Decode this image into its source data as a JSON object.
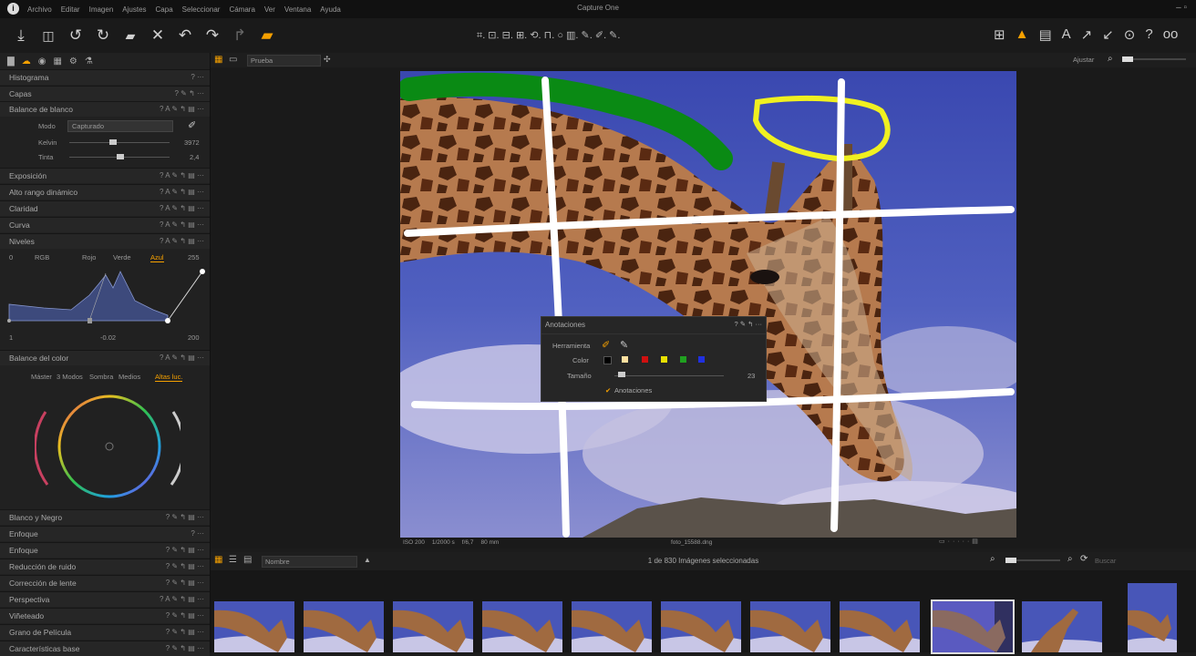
{
  "titlebar": {
    "app_title": "Capture One",
    "menu": [
      "Archivo",
      "Editar",
      "Imagen",
      "Ajustes",
      "Capa",
      "Seleccionar",
      "Cámara",
      "Ver",
      "Ventana",
      "Ayuda"
    ],
    "window_controls": "–  ▫"
  },
  "toolbar": {
    "left_icons": [
      "import-icon",
      "camera-icon",
      "undo-icon",
      "redo-icon",
      "copy-adjustments-icon",
      "reset-icon",
      "rotate-left-icon",
      "rotate-right-icon",
      "warning-icon",
      "eraser-icon"
    ],
    "center_tools": "⌗. ⊡. ⊟. ⊞. ⟲. ⊓. ○ ▥. ✎. ✐. ✎.",
    "right_glyphs": [
      "⊞",
      "▲",
      "▤",
      "A",
      "↗",
      "↙",
      "⊙",
      "?",
      "oo"
    ]
  },
  "left_panel": {
    "sections": [
      {
        "label": "Histograma",
        "icons": "? ···"
      },
      {
        "label": "Capas",
        "icons": "? ✎ ↰ ···"
      },
      {
        "label": "Balance de blanco",
        "icons": "? A ✎ ↰ ▤ ···"
      },
      {
        "label": "Exposición",
        "icons": "? A ✎ ↰ ▤ ···"
      },
      {
        "label": "Alto rango dinámico",
        "icons": "? A ✎ ↰ ▤ ···"
      },
      {
        "label": "Claridad",
        "icons": "? A ✎ ↰ ▤ ···"
      },
      {
        "label": "Curva",
        "icons": "? A ✎ ↰ ▤ ···"
      },
      {
        "label": "Niveles",
        "icons": "? A ✎ ↰ ▤ ···"
      },
      {
        "label": "Balance del color",
        "icons": "? A ✎ ↰ ▤ ···"
      },
      {
        "label": "Blanco y Negro",
        "icons": "? ✎ ↰ ▤ ···"
      },
      {
        "label": "Enfoque",
        "icons": "? ···"
      },
      {
        "label": "Enfoque",
        "icons": "? ✎ ↰ ▤ ···"
      },
      {
        "label": "Reducción de ruido",
        "icons": "? ✎ ↰ ▤ ···"
      },
      {
        "label": "Corrección de lente",
        "icons": "? ✎ ↰ ▤ ···"
      },
      {
        "label": "Perspectiva",
        "icons": "? A ✎ ↰ ▤ ···"
      },
      {
        "label": "Viñeteado",
        "icons": "? ✎ ↰ ▤ ···"
      },
      {
        "label": "Grano de Película",
        "icons": "? ✎ ↰ ▤ ···"
      },
      {
        "label": "Características base",
        "icons": "? ✎ ↰ ▤ ···"
      }
    ],
    "white_balance": {
      "mode_label": "Modo",
      "mode_value": "Capturado",
      "kelvin_label": "Kelvin",
      "kelvin_value": "3972",
      "tint_label": "Tinta",
      "tint_value": "2,4"
    },
    "levels": {
      "channels": [
        "RGB",
        "Rojo",
        "Verde",
        "Azul"
      ],
      "active_channel": "Azul",
      "in_low": "0",
      "in_high": "255",
      "out_low": "1",
      "mid": "-0.02",
      "out_high": "200"
    },
    "color_balance": {
      "tabs": [
        "Máster",
        "3 Modos",
        "Sombra",
        "Medios",
        "Altas luc."
      ]
    }
  },
  "viewer_bar": {
    "mode_select": "Prueba",
    "zoom_label": "Ajustar"
  },
  "image_info": {
    "iso": "ISO 200",
    "shutter": "1/2000 s",
    "aperture": "f/6,7",
    "focal": "80 mm",
    "filename": "foto_15588.dng"
  },
  "annotations_panel": {
    "title": "Anotaciones",
    "tool_label": "Herramienta",
    "color_label": "Color",
    "size_label": "Tamaño",
    "size_value": "23",
    "checkbox_label": "Anotaciones",
    "colors": [
      "#000000",
      "#ffe0a0",
      "#d01010",
      "#e8e000",
      "#20a020",
      "#2030e0"
    ]
  },
  "filmstrip_bar": {
    "sort_select": "Nombre",
    "count_text": "1 de 830 Imágenes seleccionadas",
    "search_placeholder": "Buscar"
  }
}
